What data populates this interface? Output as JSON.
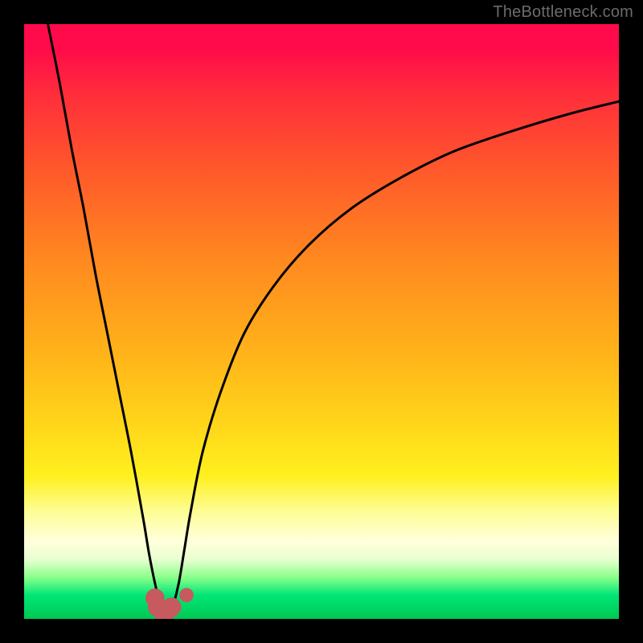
{
  "watermark": {
    "text": "TheBottleneck.com"
  },
  "colors": {
    "frame": "#000000",
    "curve": "#000000",
    "marker": "#c65a5f",
    "gradient_stops": [
      "#ff0a4a",
      "#ff2e3b",
      "#ff5a2a",
      "#ff8a1f",
      "#ffb21a",
      "#ffd81a",
      "#fff01f",
      "#fdfd96",
      "#ffffdc",
      "#e8ffd0",
      "#8aff8a",
      "#00e676",
      "#00c853"
    ]
  },
  "chart_data": {
    "type": "line",
    "title": "",
    "xlabel": "",
    "ylabel": "",
    "xlim": [
      0,
      100
    ],
    "ylim": [
      0,
      100
    ],
    "series": [
      {
        "name": "bottleneck-curve-left",
        "x": [
          4,
          6,
          8,
          10,
          12,
          14,
          16,
          18,
          20,
          21,
          22,
          23,
          23.5
        ],
        "values": [
          100,
          90,
          79,
          69,
          58,
          48,
          38,
          28,
          17,
          11,
          6,
          2,
          1
        ]
      },
      {
        "name": "bottleneck-curve-right",
        "x": [
          24.5,
          25,
          26,
          27,
          28,
          30,
          33,
          37,
          42,
          48,
          55,
          63,
          72,
          82,
          92,
          100
        ],
        "values": [
          1,
          2,
          6,
          12,
          18,
          28,
          38,
          48,
          56,
          63,
          69,
          74,
          78.5,
          82,
          85,
          87
        ]
      }
    ],
    "markers": [
      {
        "name": "valley-left",
        "x": 22.0,
        "y": 3.5,
        "r": 1.6
      },
      {
        "name": "valley-mid-1",
        "x": 22.4,
        "y": 2.0,
        "r": 1.6
      },
      {
        "name": "valley-mid-2",
        "x": 23.2,
        "y": 1.3,
        "r": 1.6
      },
      {
        "name": "valley-mid-3",
        "x": 24.0,
        "y": 1.3,
        "r": 1.6
      },
      {
        "name": "valley-mid-4",
        "x": 24.8,
        "y": 2.0,
        "r": 1.6
      },
      {
        "name": "valley-right",
        "x": 27.3,
        "y": 4.0,
        "r": 1.2
      }
    ]
  }
}
